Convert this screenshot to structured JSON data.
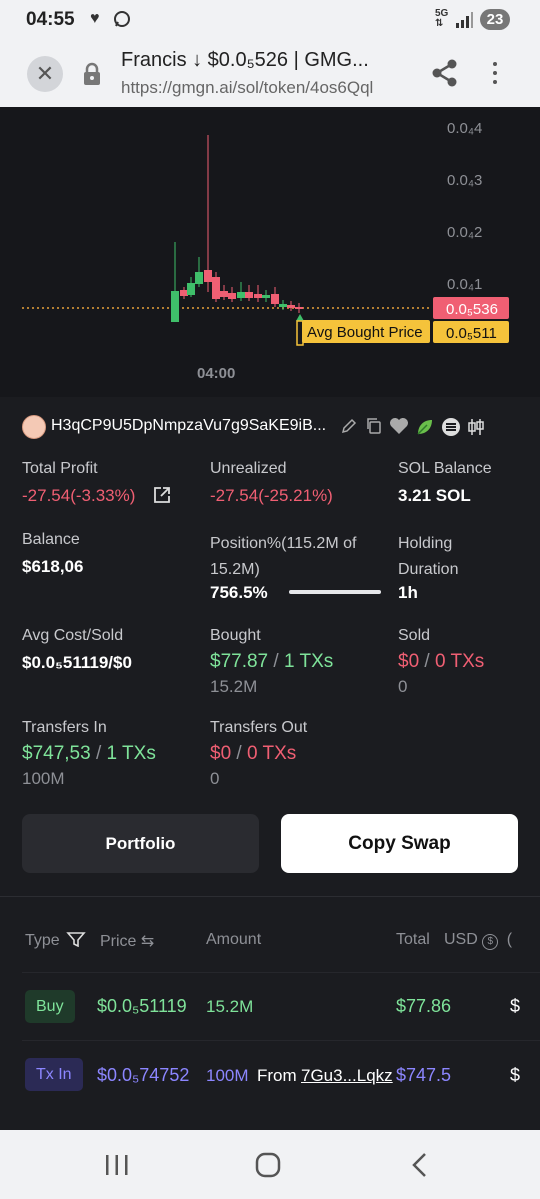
{
  "status_bar": {
    "time": "04:55",
    "network": "5G",
    "battery": "23"
  },
  "browser": {
    "page_title": "Francis ↓ $0.0₅526 | GMG...",
    "url": "https://gmgn.ai/sol/token/4os6Qql"
  },
  "chart": {
    "price_axis": [
      "0.0₄4",
      "0.0₄3",
      "0.0₄2",
      "0.0₄1"
    ],
    "current_price_tag": "0.0₅536",
    "avg_price_tag": "0.0₅511",
    "avg_bought_label": "Avg Bought Price",
    "time_label": "04:00",
    "colors": {
      "up": "#3fbf6a",
      "down": "#f05f73",
      "avg": "#f5c33b"
    }
  },
  "wallet": {
    "address": "H3qCP9U5DpNmpzaVu7g9SaKE9iB..."
  },
  "stats": {
    "total_profit_label": "Total Profit",
    "total_profit_value": "-27.54(-3.33%)",
    "unrealized_label": "Unrealized",
    "unrealized_value": "-27.54(-25.21%)",
    "sol_balance_label": "SOL Balance",
    "sol_balance_value": "3.21 SOL",
    "balance_label": "Balance",
    "balance_value": "$618,06",
    "position_label": "Position%(115.2M of 15.2M)",
    "position_value": "756.5%",
    "position_fill": 1.0,
    "holding_label": "Holding Duration",
    "holding_value": "1h",
    "avg_cost_label": "Avg Cost/Sold",
    "avg_cost_value": "$0.0₅51119/$0",
    "bought_label": "Bought",
    "bought_usd": "$77.87",
    "bought_txs": "1 TXs",
    "bought_amount": "15.2M",
    "sold_label": "Sold",
    "sold_usd": "$0",
    "sold_txs": "0 TXs",
    "sold_amount": "0",
    "transfers_in_label": "Transfers In",
    "transfers_in_usd": "$747,53",
    "transfers_in_txs": "1 TXs",
    "transfers_in_amount": "100M",
    "transfers_out_label": "Transfers Out",
    "transfers_out_usd": "$0",
    "transfers_out_txs": "0 TXs",
    "transfers_out_amount": "0",
    "separator": "/"
  },
  "buttons": {
    "portfolio": "Portfolio",
    "copy_swap": "Copy Swap"
  },
  "table": {
    "headers": {
      "type": "Type",
      "price": "Price",
      "amount": "Amount",
      "total": "Total",
      "usd": "USD"
    },
    "rows": [
      {
        "type": "Buy",
        "price": "$0.0₅51119",
        "amount": "15.2M",
        "from_label": "",
        "from": "",
        "total": "$77.86"
      },
      {
        "type": "Tx In",
        "price": "$0.0₅74752",
        "amount": "100M",
        "from_label": "From",
        "from": "7Gu3...Lqkz",
        "total": "$747.5"
      }
    ]
  }
}
